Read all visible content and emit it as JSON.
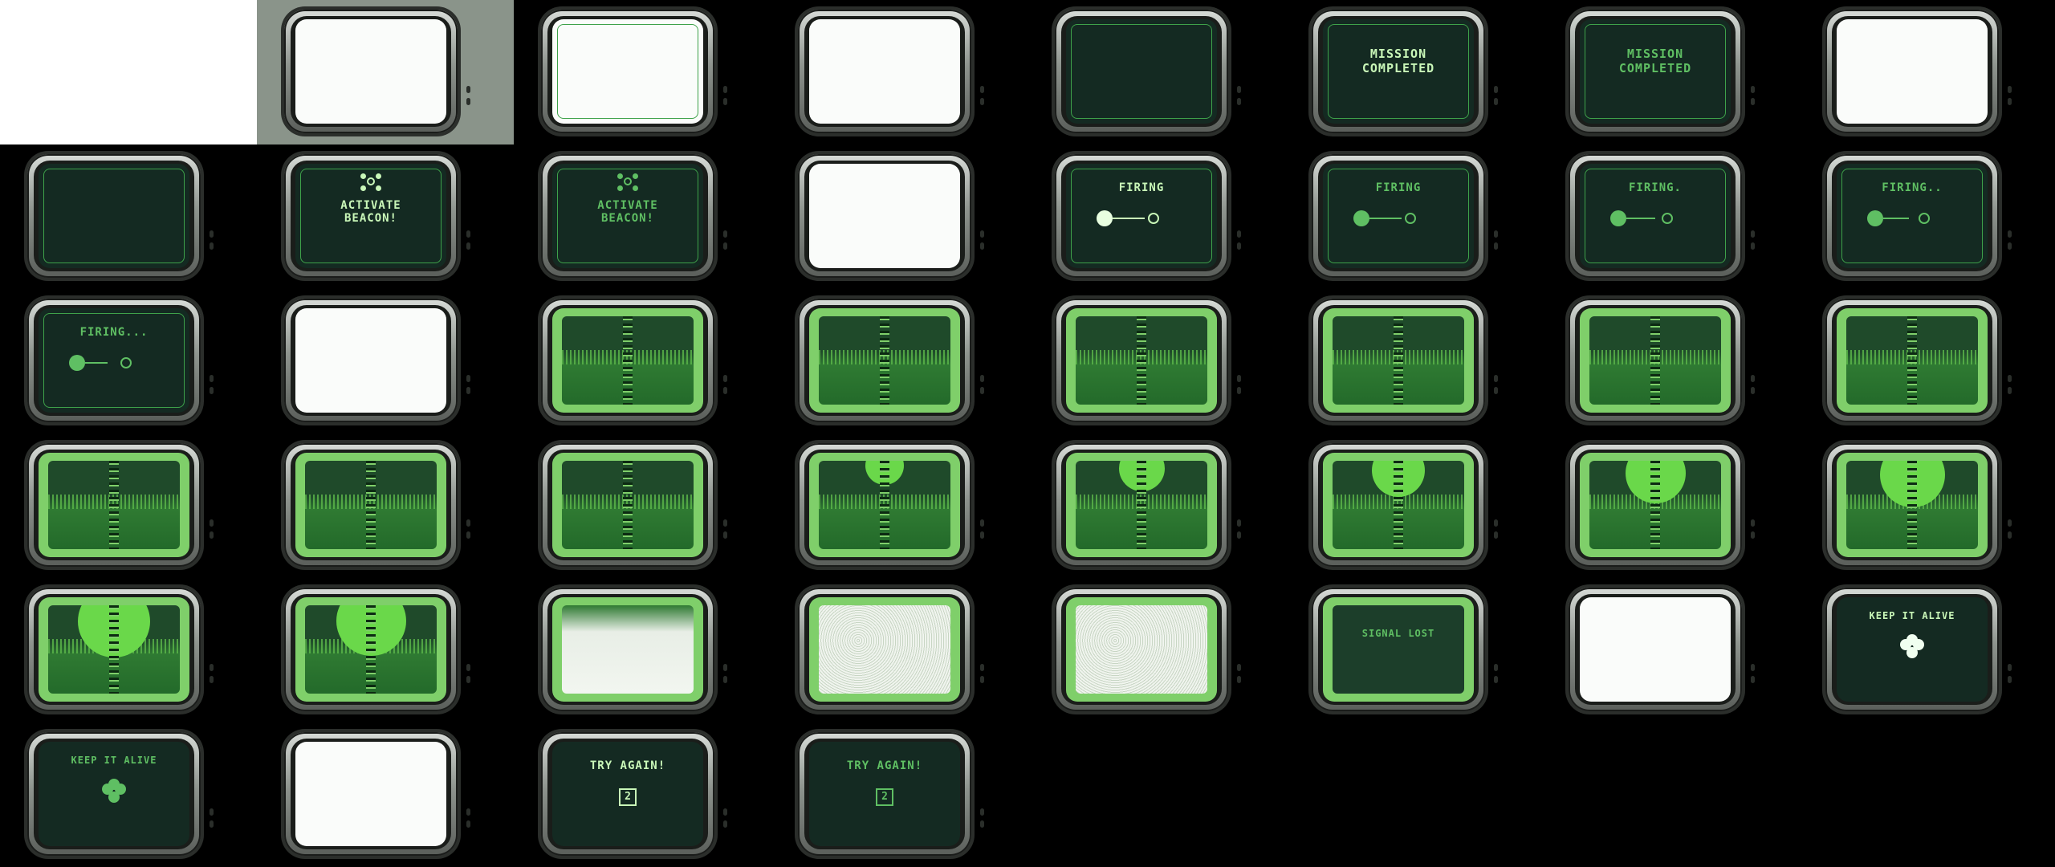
{
  "spritesheet": {
    "layout": {
      "columns": 8,
      "rows": 6
    },
    "frames": [
      {
        "kind": "blank"
      },
      {
        "kind": "tv-glare"
      },
      {
        "kind": "white-edge"
      },
      {
        "kind": "white"
      },
      {
        "kind": "empty"
      },
      {
        "kind": "text",
        "lines": [
          "MISSION",
          "COMPLETED"
        ],
        "tone": "bright"
      },
      {
        "kind": "text",
        "lines": [
          "MISSION",
          "COMPLETED"
        ],
        "tone": "dim"
      },
      {
        "kind": "white"
      },
      {
        "kind": "empty"
      },
      {
        "kind": "beacon",
        "lines": [
          "ACTIVATE",
          "BEACON!"
        ],
        "tone": "bright"
      },
      {
        "kind": "beacon",
        "lines": [
          "ACTIVATE",
          "BEACON!"
        ],
        "tone": "dim"
      },
      {
        "kind": "white"
      },
      {
        "kind": "firing",
        "text": "FIRING",
        "tone": "bright",
        "line": 40
      },
      {
        "kind": "firing",
        "text": "FIRING",
        "tone": "dim",
        "line": 40
      },
      {
        "kind": "firing",
        "text": "FIRING.",
        "tone": "dim",
        "line": 36
      },
      {
        "kind": "firing",
        "text": "FIRING..",
        "tone": "dim",
        "line": 32
      },
      {
        "kind": "firing",
        "text": "FIRING...",
        "tone": "dim",
        "line": 28
      },
      {
        "kind": "white"
      },
      {
        "kind": "play",
        "sun": 0
      },
      {
        "kind": "play",
        "sun": 0
      },
      {
        "kind": "play",
        "sun": 0
      },
      {
        "kind": "play",
        "sun": 0
      },
      {
        "kind": "play",
        "sun": 0
      },
      {
        "kind": "play",
        "sun": 0
      },
      {
        "kind": "play",
        "sun": 0
      },
      {
        "kind": "play",
        "sun": 0
      },
      {
        "kind": "play",
        "sun": 0
      },
      {
        "kind": "play",
        "sun": 0.3
      },
      {
        "kind": "play",
        "sun": 0.45
      },
      {
        "kind": "play",
        "sun": 0.6
      },
      {
        "kind": "play",
        "sun": 0.75
      },
      {
        "kind": "play",
        "sun": 0.85
      },
      {
        "kind": "play",
        "sun": 1
      },
      {
        "kind": "play",
        "sun": 0.95
      },
      {
        "kind": "static-partial"
      },
      {
        "kind": "static"
      },
      {
        "kind": "static"
      },
      {
        "kind": "text-frame",
        "lines": [
          "SIGNAL LOST"
        ],
        "tone": "dim"
      },
      {
        "kind": "white"
      },
      {
        "kind": "heart",
        "lines": [
          "KEEP IT ALIVE"
        ],
        "tone": "bright"
      },
      {
        "kind": "heart",
        "lines": [
          "KEEP IT ALIVE"
        ],
        "tone": "dim"
      },
      {
        "kind": "white"
      },
      {
        "kind": "retry",
        "lines": [
          "TRY AGAIN!"
        ],
        "number": "2",
        "tone": "bright"
      },
      {
        "kind": "retry",
        "lines": [
          "TRY AGAIN!"
        ],
        "number": "2",
        "tone": "dim"
      }
    ]
  }
}
